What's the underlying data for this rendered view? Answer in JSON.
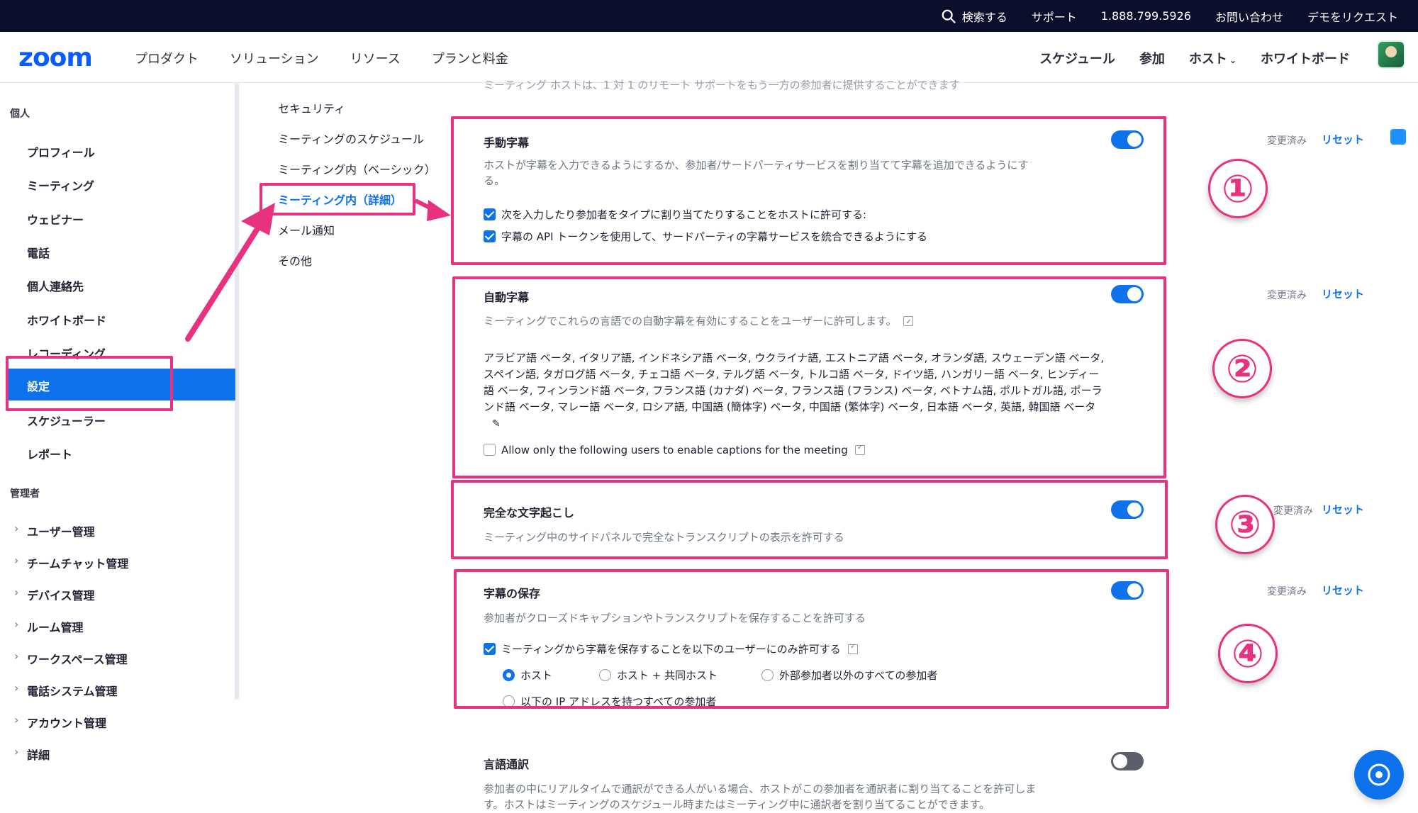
{
  "topbar": {
    "search": "検索する",
    "support": "サポート",
    "phone": "1.888.799.5926",
    "contact": "お問い合わせ",
    "demo": "デモをリクエスト"
  },
  "navbar": {
    "logo": "zoom",
    "items": [
      "プロダクト",
      "ソリューション",
      "リソース",
      "プランと料金"
    ],
    "right": {
      "schedule": "スケジュール",
      "join": "参加",
      "host": "ホスト",
      "whiteboard": "ホワイトボード"
    }
  },
  "sidebar": {
    "personal_header": "個人",
    "personal": [
      "プロフィール",
      "ミーティング",
      "ウェビナー",
      "電話",
      "個人連絡先",
      "ホワイトボード",
      "レコーディング"
    ],
    "active": "設定",
    "personal_after": [
      "スケジューラー",
      "レポート"
    ],
    "admin_header": "管理者",
    "admin": [
      "ユーザー管理",
      "チームチャット管理",
      "デバイス管理",
      "ルーム管理",
      "ワークスペース管理",
      "電話システム管理",
      "アカウント管理",
      "詳細"
    ]
  },
  "subnav": {
    "items": [
      "セキュリティ",
      "ミーティングのスケジュール",
      "ミーティング内（ベーシック）",
      "ミーティング内（詳細）",
      "メール通知",
      "その他"
    ],
    "active_index": 3
  },
  "faded_text": "ミーティング ホストは、1 対 1 のリモート サポートをもう一方の参加者に提供することができます",
  "labels": {
    "changed": "変更済み",
    "reset": "リセット"
  },
  "settings": {
    "manual": {
      "title": "手動字幕",
      "desc": "ホストが字幕を入力できるようにするか、参加者/サードパーティサービスを割り当てて字幕を追加できるようにする。",
      "opt1": "次を入力したり参加者をタイプに割り当てたりすることをホストに許可する:",
      "opt2": "字幕の API トークンを使用して、サードパーティの字幕サービスを統合できるようにする",
      "enabled": true
    },
    "auto": {
      "title": "自動字幕",
      "desc": "ミーティングでこれらの言語での自動字幕を有効にすることをユーザーに許可します。",
      "languages": "アラビア語 ベータ, イタリア語, インドネシア語 ベータ, ウクライナ語, エストニア語 ベータ, オランダ語, スウェーデン語 ベータ, スペイン語, タガログ語 ベータ, チェコ語 ベータ, テルグ語 ベータ, トルコ語 ベータ, ドイツ語, ハンガリー語 ベータ, ヒンディー語 ベータ, フィンランド語 ベータ, フランス語 (カナダ) ベータ, フランス語 (フランス) ベータ, ベトナム語, ポルトガル語, ポーランド語 ベータ, マレー語 ベータ, ロシア語, 中国語 (簡体字) ベータ, 中国語 (繁体字) ベータ, 日本語 ベータ, 英語, 韓国語 ベータ",
      "allow_only": "Allow only the following users to enable captions for the meeting",
      "enabled": true
    },
    "transcript": {
      "title": "完全な文字起こし",
      "desc": "ミーティング中のサイドパネルで完全なトランスクリプトの表示を許可する",
      "enabled": true
    },
    "save": {
      "title": "字幕の保存",
      "desc": "参加者がクローズドキャプションやトランスクリプトを保存することを許可する",
      "opt": "ミーティングから字幕を保存することを以下のユーザーにのみ許可する",
      "radio1": "ホスト",
      "radio2": "ホスト + 共同ホスト",
      "radio3": "外部参加者以外のすべての参加者",
      "radio4": "以下の IP アドレスを持つすべての参加者",
      "enabled": true
    },
    "interpretation": {
      "title": "言語通訳",
      "desc": "参加者の中にリアルタイムで通訳ができる人がいる場合、ホストがこの参加者を通訳者に割り当てることを許可します。ホストはミーティングのスケジュール時またはミーティング中に通訳者を割り当てることができます。",
      "enabled": false
    }
  },
  "annotations": [
    "①",
    "②",
    "③",
    "④"
  ],
  "colors": {
    "accent": "#0e72ed",
    "highlight": "#e8317f",
    "topbar": "#0b0f2b"
  }
}
